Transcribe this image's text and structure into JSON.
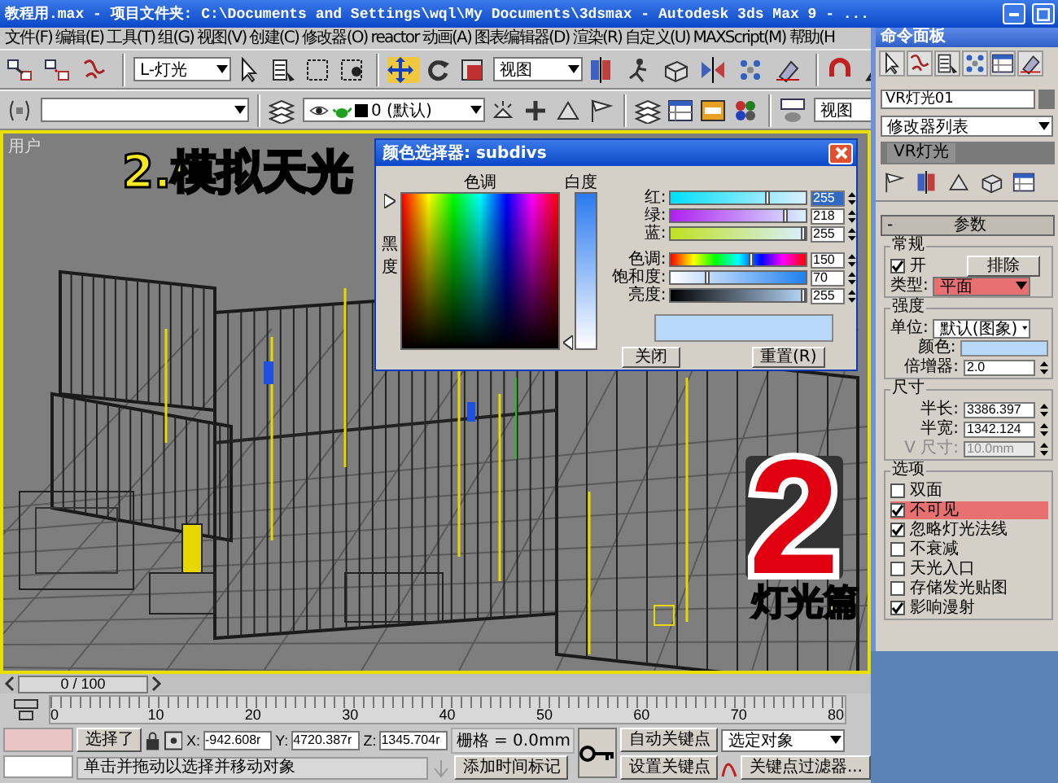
{
  "window": {
    "title": "教程用.max   - 项目文件夹: C:\\Documents and Settings\\wql\\My Documents\\3dsmax   - Autodesk 3ds Max 9   - ..."
  },
  "menu": [
    "文件(F)",
    "编辑(E)",
    "工具(T)",
    "组(G)",
    "视图(V)",
    "创建(C)",
    "修改器(O)",
    "reactor",
    "动画(A)",
    "图表编辑器(D)",
    "渲染(R)",
    "自定义(U)",
    "MAXScript(M)",
    "帮助(H"
  ],
  "main_toolbar": {
    "selection_filter": "L-灯光",
    "reference_coordinate": "视图"
  },
  "layer_toolbar": {
    "layer": "0 (默认)",
    "view": "视图"
  },
  "viewport": {
    "label": "用户",
    "heading": "2.模拟天光",
    "big_number": "2",
    "caption": "灯光篇"
  },
  "color_dialog": {
    "title": "颜色选择器: subdivs",
    "hue_label": "色调",
    "whiteness_label": "白度",
    "blackness_label": "黑度",
    "channels": [
      {
        "kind": "red",
        "label": "红:",
        "value": "255",
        "level": 0.72,
        "focused": true
      },
      {
        "kind": "green",
        "label": "绿:",
        "value": "218",
        "level": 0.85,
        "focused": false
      },
      {
        "kind": "blue",
        "label": "蓝:",
        "value": "255",
        "level": 0.98,
        "focused": false
      },
      {
        "kind": "hue",
        "label": "色调:",
        "value": "150",
        "level": 0.59,
        "focused": false
      },
      {
        "kind": "saturation",
        "label": "饱和度:",
        "value": "70",
        "level": 0.27,
        "focused": false
      },
      {
        "kind": "value",
        "label": "亮度:",
        "value": "255",
        "level": 0.98,
        "focused": false
      }
    ],
    "preview": {
      "color": "#b8d8fa"
    },
    "buttons": [
      "关闭",
      "重置(R)"
    ]
  },
  "command_panel": {
    "title": "命令面板",
    "object_name": "VR灯光01",
    "modifier_list": "修改器列表",
    "stack": [
      "VR灯光"
    ],
    "rollout": {
      "toggle": "-",
      "title": "参数"
    },
    "groups": [
      {
        "title": "常规",
        "rows": [
          {
            "kind": "check-button",
            "label": "开",
            "checked": true,
            "button": "排除"
          },
          {
            "kind": "dropdown",
            "label": "类型:",
            "value": "平面",
            "highlighted": true
          }
        ]
      },
      {
        "title": "强度",
        "rows": [
          {
            "kind": "dropdown",
            "label": "单位:",
            "value": "默认(图象)",
            "highlighted": false
          },
          {
            "kind": "swatch",
            "label": "颜色:",
            "color": "#b8d8fa"
          },
          {
            "kind": "spinner",
            "label": "倍增器:",
            "value": "2.0",
            "disabled": false
          }
        ]
      },
      {
        "title": "尺寸",
        "rows": [
          {
            "kind": "spinner",
            "label": "半长:",
            "value": "3386.397",
            "disabled": false
          },
          {
            "kind": "spinner",
            "label": "半宽:",
            "value": "1342.124",
            "disabled": false
          },
          {
            "kind": "spinner",
            "label": "V 尺寸:",
            "value": "10.0mm",
            "disabled": true
          }
        ]
      },
      {
        "title": "选项",
        "rows": [
          {
            "kind": "checkbox",
            "label": "双面",
            "checked": false,
            "highlighted": false
          },
          {
            "kind": "checkbox",
            "label": "不可见",
            "checked": true,
            "highlighted": true
          },
          {
            "kind": "checkbox",
            "label": "忽略灯光法线",
            "checked": true,
            "highlighted": false
          },
          {
            "kind": "checkbox",
            "label": "不衰减",
            "checked": false,
            "highlighted": false
          },
          {
            "kind": "checkbox",
            "label": "天光入口",
            "checked": false,
            "highlighted": false
          },
          {
            "kind": "checkbox",
            "label": "存储发光贴图",
            "checked": false,
            "highlighted": false
          },
          {
            "kind": "checkbox",
            "label": "影响漫射",
            "checked": true,
            "highlighted": false
          }
        ]
      }
    ]
  },
  "time_slider": {
    "position": "0 / 100"
  },
  "track_bar": {
    "ticks": [
      "0",
      "10",
      "20",
      "30",
      "40",
      "50",
      "60",
      "70",
      "80"
    ]
  },
  "status_bar": {
    "selection": "选择了",
    "coords": [
      {
        "label": "X:",
        "value": "-942.608r"
      },
      {
        "label": "Y:",
        "value": "4720.387r"
      },
      {
        "label": "Z:",
        "value": "1345.704r"
      }
    ],
    "grid": "栅格 = 0.0mm",
    "prompt": "单击并拖动以选择并移动对象",
    "add_time_tag": "添加时间标记",
    "auto_key": "自动关键点",
    "key_target": "选定对象",
    "set_key": "设置关键点",
    "key_filters": "关键点过滤器..."
  }
}
